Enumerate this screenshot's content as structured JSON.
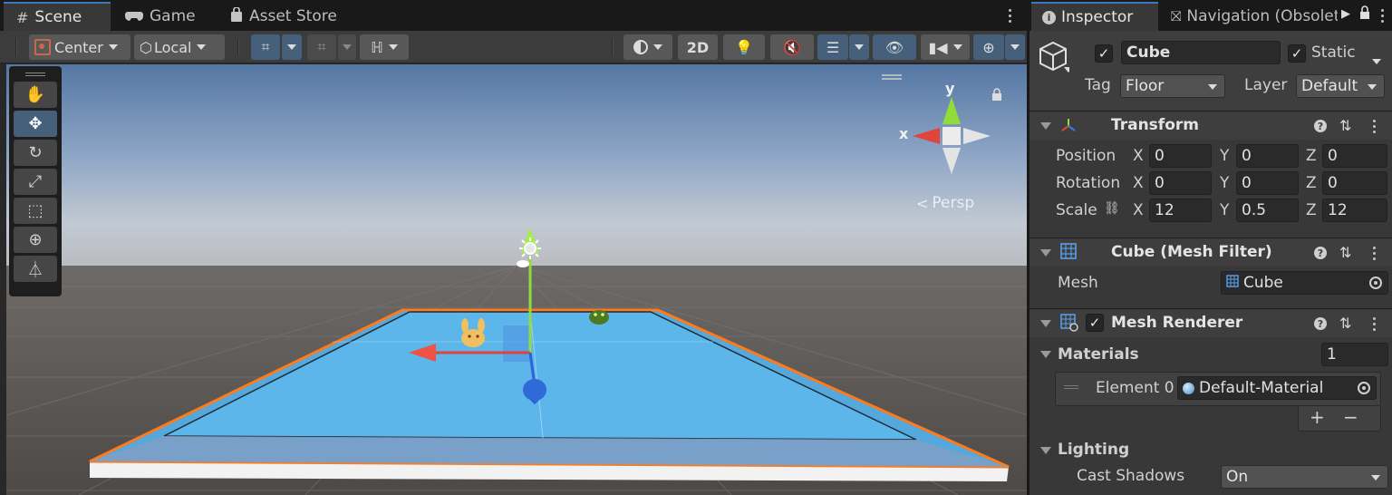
{
  "scene_window": {
    "tabs": [
      {
        "icon": "grid-icon",
        "label": "Scene"
      },
      {
        "icon": "gamepad-icon",
        "label": "Game"
      },
      {
        "icon": "bag-icon",
        "label": "Asset Store"
      }
    ],
    "toolbar": {
      "pivot_label": "Center",
      "space_label": "Local",
      "mode_2d_label": "2D"
    },
    "gizmo": {
      "y_label": "y",
      "x_label": "x",
      "projection_label": "Persp"
    },
    "tools": [
      "hand-tool",
      "move-tool",
      "rotate-tool",
      "scale-tool",
      "rect-tool",
      "transform-tool",
      "custom-tool"
    ]
  },
  "inspector": {
    "tabs": [
      {
        "icon": "info-icon",
        "label": "Inspector"
      },
      {
        "icon": "navigation-icon",
        "label": "Navigation (Obsolete)"
      }
    ],
    "object": {
      "active": true,
      "name": "Cube",
      "static_label": "Static",
      "static_checked": true,
      "tag_label": "Tag",
      "tag_value": "Floor",
      "layer_label": "Layer",
      "layer_value": "Default"
    },
    "transform": {
      "title": "Transform",
      "position": {
        "label": "Position",
        "x": "0",
        "y": "0",
        "z": "0"
      },
      "rotation": {
        "label": "Rotation",
        "x": "0",
        "y": "0",
        "z": "0"
      },
      "scale": {
        "label": "Scale",
        "x": "12",
        "y": "0.5",
        "z": "12"
      },
      "axis_x": "X",
      "axis_y": "Y",
      "axis_z": "Z"
    },
    "mesh_filter": {
      "title": "Cube (Mesh Filter)",
      "mesh_label": "Mesh",
      "mesh_value": "Cube"
    },
    "mesh_renderer": {
      "title": "Mesh Renderer",
      "enabled": true,
      "materials_label": "Materials",
      "materials_count": "1",
      "element_label": "Element 0",
      "element_value": "Default-Material",
      "add_symbol": "+",
      "remove_symbol": "−",
      "lighting_label": "Lighting",
      "cast_shadows_label": "Cast Shadows",
      "cast_shadows_value": "On"
    }
  },
  "colors": {
    "selection_outline": "#ff7a1a",
    "floor_top": "#5fb4e6",
    "axis_x": "#e0443a",
    "axis_y": "#8fdc3a",
    "axis_z": "#2a64d8",
    "active_button": "#46607c"
  }
}
